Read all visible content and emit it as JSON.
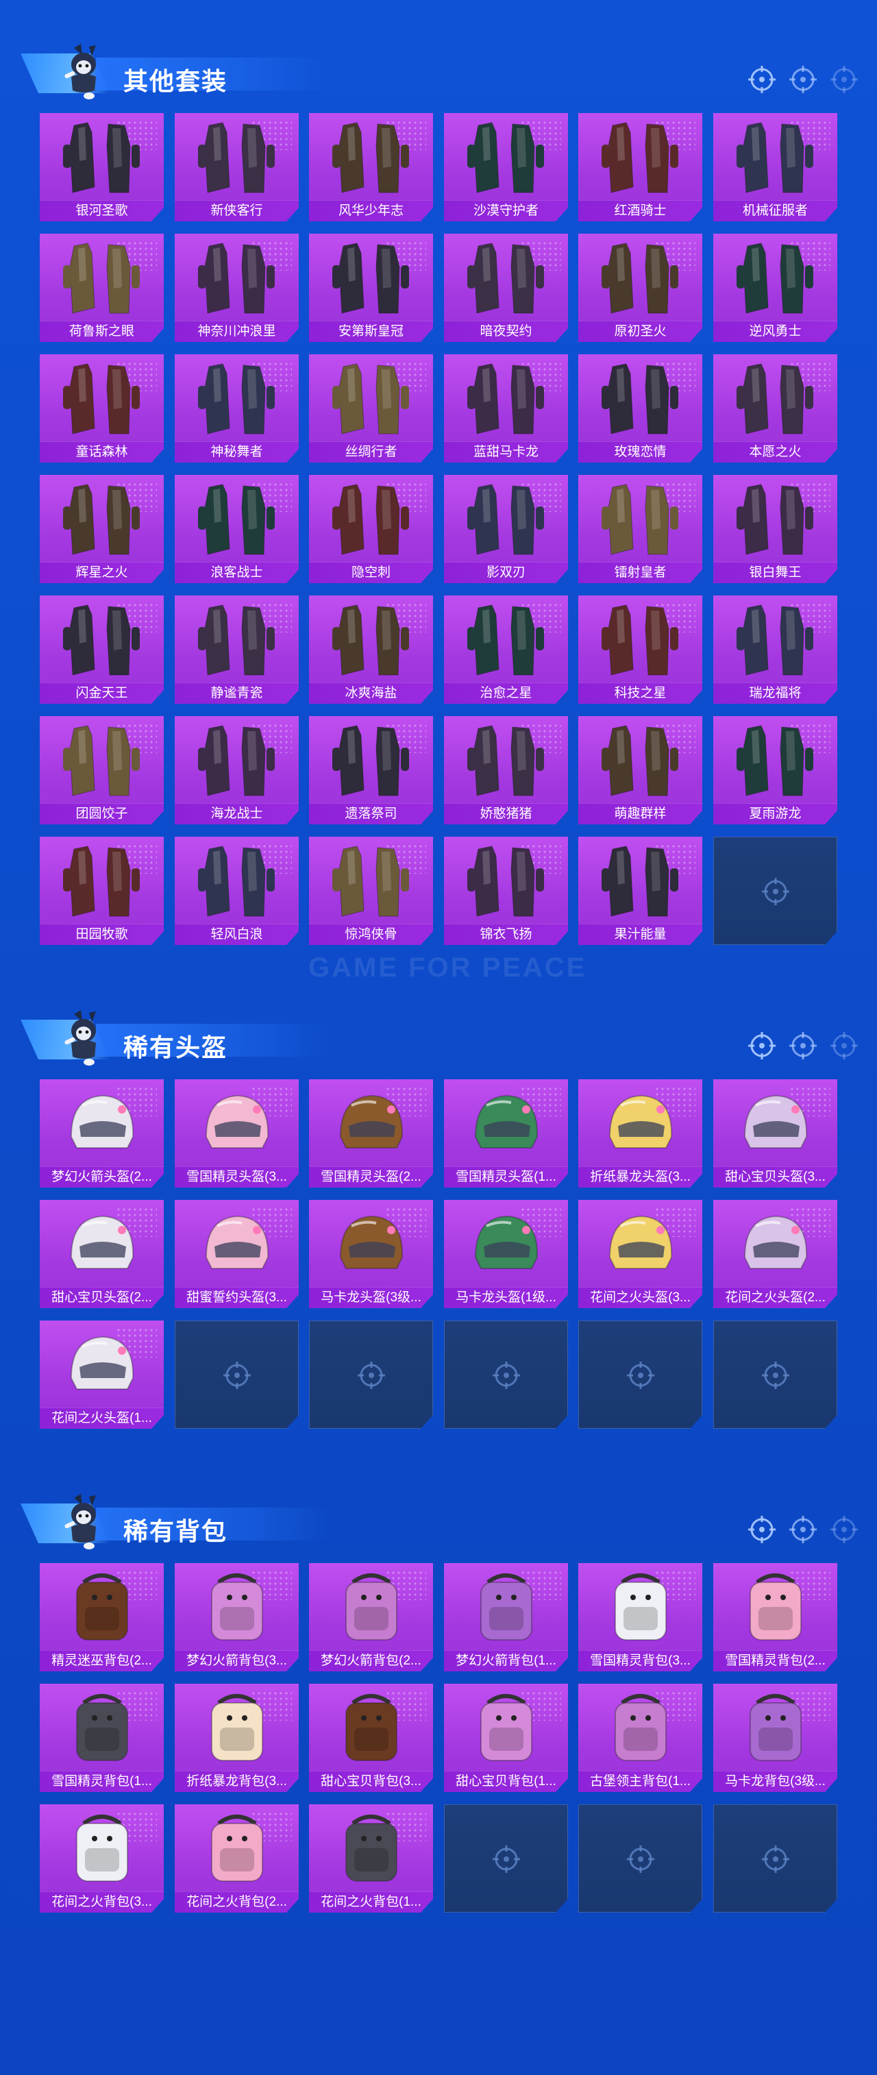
{
  "watermark": "GAME FOR PEACE",
  "sections": [
    {
      "title": "其他套装",
      "kind": "outfit",
      "items": [
        "银河圣歌",
        "新侠客行",
        "风华少年志",
        "沙漠守护者",
        "红酒骑士",
        "机械征服者",
        "荷鲁斯之眼",
        "神奈川冲浪里",
        "安第斯皇冠",
        "暗夜契约",
        "原初圣火",
        "逆风勇士",
        "童话森林",
        "神秘舞者",
        "丝绸行者",
        "蓝甜马卡龙",
        "玫瑰恋情",
        "本愿之火",
        "辉星之火",
        "浪客战士",
        "隐空刺",
        "影双刃",
        "镭射皇者",
        "银白舞王",
        "闪金天王",
        "静谧青瓷",
        "冰爽海盐",
        "治愈之星",
        "科技之星",
        "瑞龙福将",
        "团圆饺子",
        "海龙战士",
        "遗落祭司",
        "娇憨猪猪",
        "萌趣群样",
        "夏雨游龙",
        "田园牧歌",
        "轻风白浪",
        "惊鸿侠骨",
        "锦衣飞扬",
        "果汁能量"
      ],
      "slots": 42
    },
    {
      "title": "稀有头盔",
      "kind": "helmet",
      "items": [
        "梦幻火箭头盔(2...",
        "雪国精灵头盔(3...",
        "雪国精灵头盔(2...",
        "雪国精灵头盔(1...",
        "折纸暴龙头盔(3...",
        "甜心宝贝头盔(3...",
        "甜心宝贝头盔(2...",
        "甜蜜誓约头盔(3...",
        "马卡龙头盔(3级...",
        "马卡龙头盔(1级...",
        "花间之火头盔(3...",
        "花间之火头盔(2...",
        "花间之火头盔(1..."
      ],
      "slots": 18
    },
    {
      "title": "稀有背包",
      "kind": "backpack",
      "items": [
        "精灵迷巫背包(2...",
        "梦幻火箭背包(3...",
        "梦幻火箭背包(2...",
        "梦幻火箭背包(1...",
        "雪国精灵背包(3...",
        "雪国精灵背包(2...",
        "雪国精灵背包(1...",
        "折纸暴龙背包(3...",
        "甜心宝贝背包(3...",
        "甜心宝贝背包(1...",
        "古堡领主背包(1...",
        "马卡龙背包(3级...",
        "花间之火背包(3...",
        "花间之火背包(2...",
        "花间之火背包(1..."
      ],
      "slots": 18
    }
  ],
  "colors": {
    "card": "#a338e0",
    "label": "#8e22d8",
    "empty": "#1d3e7a",
    "bg": "#0f52d6"
  }
}
